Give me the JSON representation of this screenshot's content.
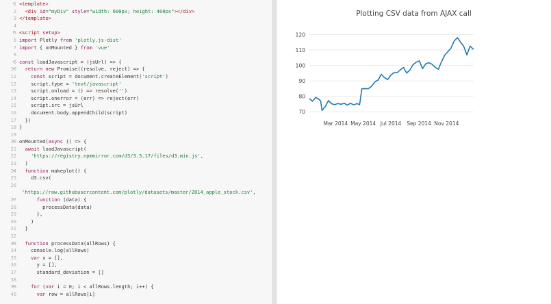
{
  "editor": {
    "lines": [
      {
        "n": "1",
        "fold": "▾",
        "parts": [
          [
            "tag",
            "<template>"
          ]
        ]
      },
      {
        "n": "2",
        "fold": "",
        "parts": [
          [
            "tag",
            "  <div "
          ],
          [
            "kw",
            "id"
          ],
          [
            "txt",
            "="
          ],
          [
            "str",
            "\"myDiv\""
          ],
          [
            "kw",
            " style"
          ],
          [
            "txt",
            "="
          ],
          [
            "str",
            "\"width: 600px; height: 400px\""
          ],
          [
            "tag",
            "></div>"
          ]
        ]
      },
      {
        "n": "3",
        "fold": "",
        "parts": [
          [
            "tag",
            "</template>"
          ]
        ]
      },
      {
        "n": "4",
        "fold": "",
        "parts": []
      },
      {
        "n": "5",
        "fold": "▾",
        "parts": [
          [
            "tag",
            "<script "
          ],
          [
            "kw",
            "setup"
          ],
          [
            "tag",
            ">"
          ]
        ]
      },
      {
        "n": "6",
        "fold": "",
        "parts": [
          [
            "kw",
            "import "
          ],
          [
            "txt",
            "Plotly "
          ],
          [
            "kw",
            "from "
          ],
          [
            "str",
            "'plotly.js-dist'"
          ]
        ]
      },
      {
        "n": "7",
        "fold": "",
        "parts": [
          [
            "kw",
            "import "
          ],
          [
            "txt",
            "{ onMounted } "
          ],
          [
            "kw",
            "from "
          ],
          [
            "str",
            "'vue'"
          ]
        ]
      },
      {
        "n": "8",
        "fold": "",
        "parts": []
      },
      {
        "n": "9",
        "fold": "▾",
        "parts": [
          [
            "kw",
            "const "
          ],
          [
            "txt",
            "loadJavascript = (jsUrl) => {"
          ]
        ]
      },
      {
        "n": "10",
        "fold": "▾",
        "parts": [
          [
            "kw",
            "  return new "
          ],
          [
            "txt",
            "Promise((resolve, reject) => {"
          ]
        ]
      },
      {
        "n": "11",
        "fold": "",
        "parts": [
          [
            "kw",
            "    const "
          ],
          [
            "txt",
            "script = document.createElement("
          ],
          [
            "str",
            "'script'"
          ],
          [
            "txt",
            ")"
          ]
        ]
      },
      {
        "n": "12",
        "fold": "",
        "parts": [
          [
            "txt",
            "    script.type = "
          ],
          [
            "str",
            "'text/javascript'"
          ]
        ]
      },
      {
        "n": "13",
        "fold": "",
        "parts": [
          [
            "txt",
            "    script.onload = () => resolve("
          ],
          [
            "str",
            "''"
          ],
          [
            "txt",
            ")"
          ]
        ]
      },
      {
        "n": "14",
        "fold": "",
        "parts": [
          [
            "txt",
            "    script.onerror = (err) => reject(err)"
          ]
        ]
      },
      {
        "n": "15",
        "fold": "",
        "parts": [
          [
            "txt",
            "    script.src = jsUrl"
          ]
        ]
      },
      {
        "n": "16",
        "fold": "",
        "parts": [
          [
            "txt",
            "    document.body.appendChild(script)"
          ]
        ]
      },
      {
        "n": "17",
        "fold": "",
        "parts": [
          [
            "txt",
            "  })"
          ]
        ]
      },
      {
        "n": "18",
        "fold": "",
        "parts": [
          [
            "txt",
            "}"
          ]
        ]
      },
      {
        "n": "19",
        "fold": "",
        "parts": []
      },
      {
        "n": "20",
        "fold": "▾",
        "parts": [
          [
            "txt",
            "onMounted("
          ],
          [
            "kw",
            "async "
          ],
          [
            "txt",
            "() => {"
          ]
        ]
      },
      {
        "n": "21",
        "fold": "",
        "parts": [
          [
            "kw",
            "  await "
          ],
          [
            "txt",
            "loadJavascript("
          ]
        ]
      },
      {
        "n": "22",
        "fold": "",
        "parts": [
          [
            "str",
            "    'https://registry.npmmirror.com/d3/3.5.17/files/d3.min.js'"
          ],
          [
            "txt",
            ","
          ]
        ]
      },
      {
        "n": "23",
        "fold": "",
        "parts": [
          [
            "txt",
            "  )"
          ]
        ]
      },
      {
        "n": "24",
        "fold": "▾",
        "parts": [
          [
            "kw",
            "  function "
          ],
          [
            "txt",
            "makeplot() {"
          ]
        ]
      },
      {
        "n": "25",
        "fold": "",
        "parts": [
          [
            "txt",
            "    d3.csv("
          ]
        ]
      },
      {
        "n": "26",
        "fold": "",
        "parts": []
      },
      {
        "n": "",
        "fold": "",
        "parts": [
          [
            "str",
            "'https://raw.githubusercontent.com/plotly/datasets/master/2014_apple_stock.csv'"
          ],
          [
            "txt",
            ","
          ]
        ],
        "shift": true
      },
      {
        "n": "27",
        "fold": "▾",
        "parts": [
          [
            "kw",
            "      function "
          ],
          [
            "txt",
            "(data) {"
          ]
        ]
      },
      {
        "n": "28",
        "fold": "",
        "parts": [
          [
            "txt",
            "        processData(data)"
          ]
        ]
      },
      {
        "n": "29",
        "fold": "",
        "parts": [
          [
            "txt",
            "      },"
          ]
        ]
      },
      {
        "n": "30",
        "fold": "",
        "parts": [
          [
            "txt",
            "    )"
          ]
        ]
      },
      {
        "n": "31",
        "fold": "",
        "parts": [
          [
            "txt",
            "  }"
          ]
        ]
      },
      {
        "n": "32",
        "fold": "",
        "parts": []
      },
      {
        "n": "33",
        "fold": "▾",
        "parts": [
          [
            "kw",
            "  function "
          ],
          [
            "txt",
            "processData(allRows) {"
          ]
        ]
      },
      {
        "n": "34",
        "fold": "",
        "parts": [
          [
            "txt",
            "    console.log(allRows)"
          ]
        ]
      },
      {
        "n": "35",
        "fold": "",
        "parts": [
          [
            "kw",
            "    var "
          ],
          [
            "txt",
            "x = [],"
          ]
        ]
      },
      {
        "n": "36",
        "fold": "",
        "parts": [
          [
            "txt",
            "      y = [],"
          ]
        ]
      },
      {
        "n": "37",
        "fold": "",
        "parts": [
          [
            "txt",
            "      standard_deviation = []"
          ]
        ]
      },
      {
        "n": "38",
        "fold": "",
        "parts": []
      },
      {
        "n": "39",
        "fold": "▾",
        "parts": [
          [
            "kw",
            "    for "
          ],
          [
            "txt",
            "("
          ],
          [
            "kw",
            "var "
          ],
          [
            "txt",
            "i = "
          ],
          [
            "kw",
            "0"
          ],
          [
            "txt",
            "; i < allRows.length; i++) {"
          ]
        ]
      },
      {
        "n": "40",
        "fold": "",
        "parts": [
          [
            "kw",
            "      var "
          ],
          [
            "txt",
            "row = allRows[i]"
          ]
        ]
      }
    ]
  },
  "chart_data": {
    "type": "line",
    "title": "Plotting CSV data from AJAX call",
    "xlabel": "",
    "ylabel": "",
    "ylim": [
      67,
      122
    ],
    "xlim": [
      "2014-01-02",
      "2014-12-31"
    ],
    "x_ticks": [
      "Mar 2014",
      "May 2014",
      "Jul 2014",
      "Sep 2014",
      "Nov 2014"
    ],
    "x_tick_dates": [
      "2014-03-01",
      "2014-05-01",
      "2014-07-01",
      "2014-09-01",
      "2014-11-01"
    ],
    "y_ticks": [
      70,
      80,
      90,
      100,
      110,
      120
    ],
    "line_color": "#1f77b4",
    "grid": true,
    "series": [
      {
        "x": [
          "2014-01-02",
          "2014-01-09",
          "2014-01-16",
          "2014-01-23",
          "2014-01-27",
          "2014-01-30",
          "2014-02-06",
          "2014-02-13",
          "2014-02-20",
          "2014-02-27",
          "2014-03-06",
          "2014-03-13",
          "2014-03-20",
          "2014-03-27",
          "2014-04-03",
          "2014-04-10",
          "2014-04-17",
          "2014-04-23",
          "2014-04-28",
          "2014-05-05",
          "2014-05-12",
          "2014-05-19",
          "2014-05-27",
          "2014-06-03",
          "2014-06-10",
          "2014-06-17",
          "2014-06-24",
          "2014-07-01",
          "2014-07-08",
          "2014-07-15",
          "2014-07-22",
          "2014-07-29",
          "2014-08-05",
          "2014-08-12",
          "2014-08-19",
          "2014-08-26",
          "2014-09-02",
          "2014-09-09",
          "2014-09-16",
          "2014-09-23",
          "2014-09-30",
          "2014-10-07",
          "2014-10-14",
          "2014-10-21",
          "2014-10-28",
          "2014-11-04",
          "2014-11-11",
          "2014-11-18",
          "2014-11-25",
          "2014-12-02",
          "2014-12-09",
          "2014-12-16",
          "2014-12-23",
          "2014-12-31"
        ],
        "y": [
          78.5,
          76.8,
          79.3,
          78.1,
          77.0,
          70.9,
          73.4,
          77.2,
          75.2,
          74.6,
          75.4,
          74.8,
          75.5,
          74.3,
          75.5,
          74.4,
          75.3,
          74.6,
          84.9,
          85.0,
          84.9,
          86.4,
          89.4,
          90.6,
          94.3,
          92.1,
          90.8,
          93.7,
          95.4,
          95.3,
          97.2,
          98.7,
          95.1,
          97.0,
          100.5,
          102.1,
          103.0,
          97.9,
          101.0,
          101.8,
          100.8,
          98.8,
          97.5,
          102.5,
          106.7,
          108.9,
          111.3,
          115.9,
          118.0,
          115.1,
          112.4,
          106.8,
          112.5,
          110.4
        ]
      }
    ]
  }
}
